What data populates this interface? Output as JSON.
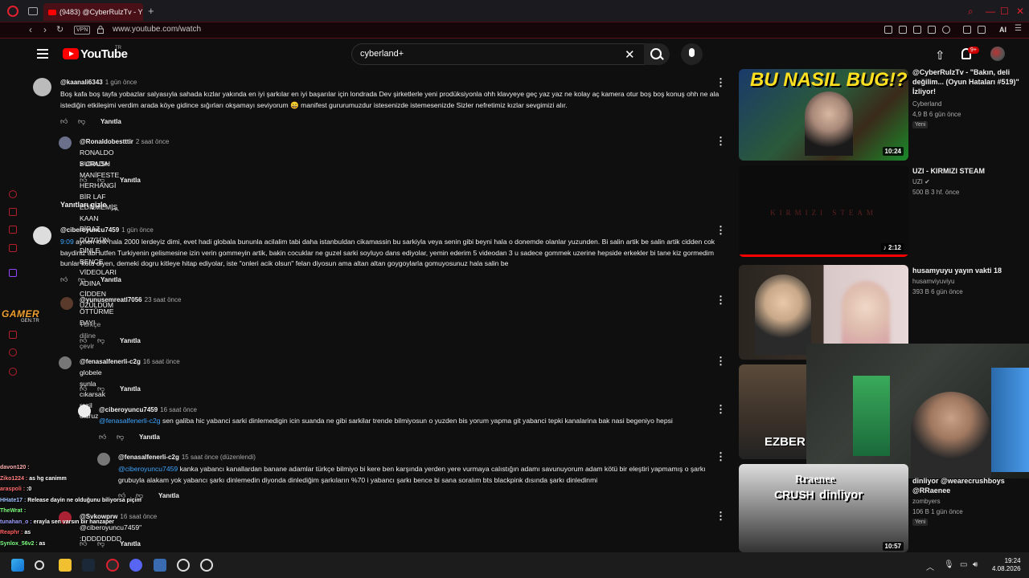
{
  "browser": {
    "tab_title": "(9483) @CyberRulzTv - YE",
    "new_tab": "+",
    "vpn_label": "VPN",
    "url": "www.youtube.com/watch",
    "ai_label": "AI"
  },
  "yt_header": {
    "logo_text": "YouTube",
    "country": "TR",
    "search_value": "cyberland+",
    "notif_count": "9+"
  },
  "colors": {
    "accent_red": "#ff0000",
    "opera_red": "#e0202e",
    "mention_blue": "#3ea6ff"
  },
  "comments": [
    {
      "author": "@kaanali6343",
      "time": "1 gün önce",
      "body": "Boş kafa boş tayfa yobazlar salyasıyla sahada kızlar yakında en iyi şarkılar en iyi başarılar için londrada Dev şirketlerle yeni prodüksiyonla ohh klavyeye geç yaz yaz ne kolay aç kamera otur boş boş konuş ohh ne ala istediğin etkileşimi verdim arada köye gidince sığırları okşamayı seviyorum 😄 manifest gururumuzdur istesenizde istemesenizde Sizler nefretimiz kızlar sevgimizi alır.",
      "reply": "Yanıtla"
    },
    {
      "author": "@Ronaldobestttir",
      "time": "2 saat önce",
      "body_line1": "RONALDO > CRUSH",
      "body_line2": "BURADA MANİFESTE HERHANGİ BİR LAF EDİLMEMİŞ KAAN BİRAZ DÜZGÜN DİNLE BENCE VİDEOLARI ADINA CİDDEN ÜZÜLDÜM",
      "reply": "Yanıtla"
    },
    {
      "hide_replies": "Yanıtları gizle"
    },
    {
      "author": "@ciberoyuncu7459",
      "time": "1 gün önce",
      "timestamp_link": "9:09",
      "body": " aynen knk hala 2000 lerdeyiz dimi, evet hadi globala bununla acilalim tabi daha istanbuldan cikamassin bu sarkiyla veya senin gibi beyni hala o donemde olanlar yuzunden. Bi salin artik be salin artik cidden cok baydiniz abi lutfen Turkiyenin gelismesine izin verin gommeyin artik, bakin cocuklar ne guzel sarki soyluyo dans ediyolar, yemin ederim 5 videodan 3 u sadece gommek uzerine hepside erkekler bi tane kiz gormedim bunlar kotu diyen, demeki dogru kitleye hitap ediyolar, iste \"onleri acik olsun\" felan diyosun ama altan altan goygoylarla gomuyosunuz hala salin be",
      "reply": "Yanıtla"
    },
    {
      "author": "@yunusemreatl7056",
      "time": "23 saat önce",
      "body": "ÖTTÜRME DAYI",
      "translate": "Türkçe diline çevir",
      "reply": "Yanıtla"
    },
    {
      "author": "@fenasalfenerli-c2g",
      "time": "16 saat önce",
      "body": "globele şunla cıkarsak rezil oluruz",
      "reply": "Yanıtla"
    },
    {
      "author": "@ciberoyuncu7459",
      "time": "16 saat önce",
      "mention": "@fenasalfenerli-c2g",
      "body": " sen galiba hic yabanci sarki dinlemedigin icin suanda ne gibi sarkilar trende bilmiyosun o yuzden bis yorum yapma git yabanci tepki kanalarina bak nasi begeniyo hepsi",
      "reply": "Yanıtla"
    },
    {
      "author": "@fenasalfenerli-c2g",
      "time": "15 saat önce (düzenlendi)",
      "mention": "@ciberoyuncu7459",
      "body": "  kanka yabancı kanallardan banane adamlar türkçe bilmiyo bi kere ben karşında yerden yere vurmaya calıstığın adamı savunuyorum adam kötü bir eleştiri yapmamış o şarkı grubuyla alakam yok yabancı şarkı dinlemedin diyonda dinlediğim şarkıların %70 i yabancı şarkı bence bi sana soralım bts blackpink dısında şarkı dinledinmi",
      "reply": "Yanıtla"
    },
    {
      "author": "@Svkowprw",
      "time": "16 saat önce",
      "body": "@ciberoyuncu7459\" :DDDDDDDD",
      "reply": "Yanıtla"
    }
  ],
  "recommendations": [
    {
      "thumb_text": "BU NASIL BUG!?",
      "title": "@CyberRulzTv - \"Bakın, deli değilim... (Oyun Hataları #519)\" İzliyor!",
      "channel": "Cyberland",
      "meta": "4,9 B   6 gün önce",
      "badge": "Yeni",
      "duration": "10:24"
    },
    {
      "thumb_text": "KIRMIZI STEAM",
      "title": "UZI - KIRMIZI STEAM",
      "channel": "UZI ✔",
      "meta": "500 B   3 hf. önce",
      "duration": "♪ 2:12"
    },
    {
      "title": "husamyuyu yayın vakti 18",
      "channel": "husamviyuviyu",
      "meta": "393 B   6 gün önce"
    },
    {
      "thumb_text": "EZBER"
    },
    {
      "thumb_text_1": "Rraenee",
      "thumb_text_2": "CRUSH",
      "thumb_text_3": "dinliyor",
      "title": "dinliyor @wearecrushboys @RRaenee",
      "channel": "zombyers",
      "meta": "106 B   1 gün önce",
      "badge": "Yeni",
      "duration": "10:57"
    }
  ],
  "chat": [
    {
      "user": "davon120 :",
      "msg": ""
    },
    {
      "user": "Ziko1224 :",
      "msg": " as hg canimm"
    },
    {
      "user": "araspoli :",
      "msg": " :0"
    },
    {
      "user": "HHate17 :",
      "msg": " Release dayin ne olduğunu biliyorsa piçim"
    },
    {
      "user": "TheWrat :",
      "msg": ""
    },
    {
      "user": "tunahan_o :",
      "msg": " erayla sen varsın bir hanzaper"
    },
    {
      "user": "Reaphr :",
      "msg": " as"
    },
    {
      "user": "Synlox_56v2 :",
      "msg": " as"
    }
  ],
  "taskbar": {
    "time": "19:24",
    "date": "4.08.2026"
  }
}
